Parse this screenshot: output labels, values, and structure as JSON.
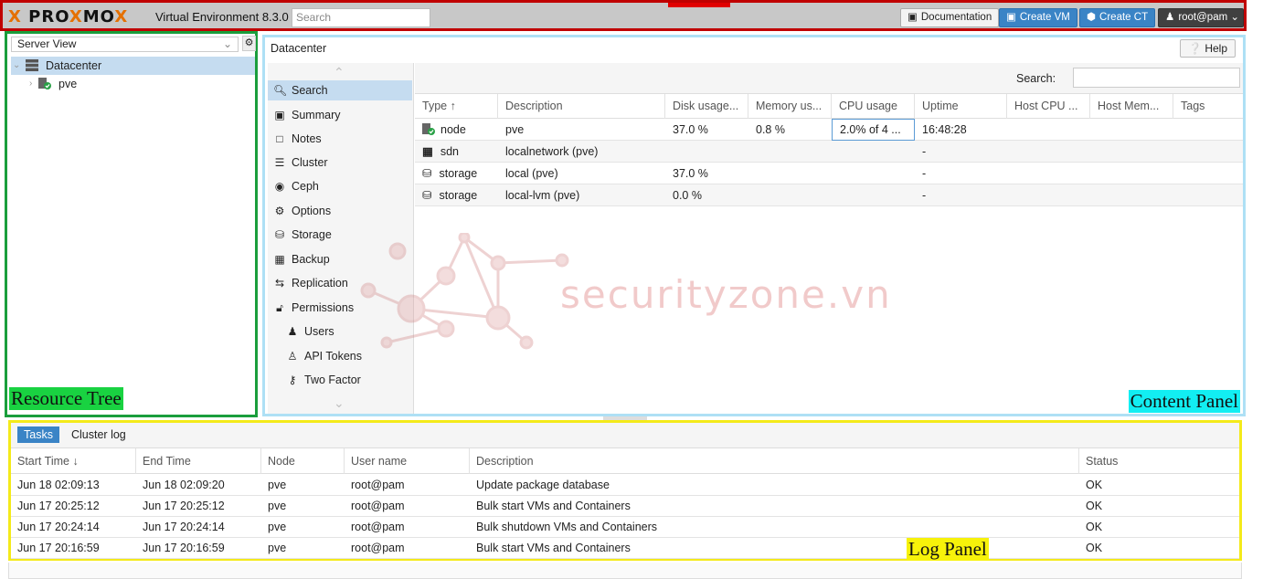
{
  "header": {
    "logo_text": "PROXMOX",
    "version": "Virtual Environment 8.3.0",
    "search_placeholder": "Search",
    "documentation": "Documentation",
    "create_vm": "Create VM",
    "create_ct": "Create CT",
    "user": "root@pam"
  },
  "tree": {
    "view": "Server View",
    "items": [
      {
        "label": "Datacenter",
        "icon": "server-rack-icon"
      },
      {
        "label": "pve",
        "icon": "node-online-icon"
      }
    ],
    "annotation": "Resource Tree"
  },
  "content": {
    "breadcrumb": "Datacenter",
    "help": "Help",
    "annotation": "Content Panel",
    "nav": [
      {
        "label": "Search",
        "icon": "search-icon"
      },
      {
        "label": "Summary",
        "icon": "book-icon"
      },
      {
        "label": "Notes",
        "icon": "note-icon"
      },
      {
        "label": "Cluster",
        "icon": "server-icon"
      },
      {
        "label": "Ceph",
        "icon": "ceph-icon"
      },
      {
        "label": "Options",
        "icon": "gear-icon"
      },
      {
        "label": "Storage",
        "icon": "database-icon"
      },
      {
        "label": "Backup",
        "icon": "floppy-icon"
      },
      {
        "label": "Replication",
        "icon": "retweet-icon"
      },
      {
        "label": "Permissions",
        "icon": "unlock-icon"
      },
      {
        "label": "Users",
        "icon": "user-icon"
      },
      {
        "label": "API Tokens",
        "icon": "user-outline-icon"
      },
      {
        "label": "Two Factor",
        "icon": "key-icon"
      }
    ],
    "search_label": "Search:",
    "columns": [
      "Type",
      "Description",
      "Disk usage...",
      "Memory us...",
      "CPU usage",
      "Uptime",
      "Host CPU ...",
      "Host Mem...",
      "Tags"
    ],
    "rows": [
      {
        "type": "node",
        "icon": "node-online-icon",
        "description": "pve",
        "disk": "37.0 %",
        "memory": "0.8 %",
        "cpu": "2.0% of 4 ...",
        "uptime": "16:48:28"
      },
      {
        "type": "sdn",
        "icon": "grid-icon",
        "description": "localnetwork (pve)",
        "disk": "",
        "memory": "",
        "cpu": "",
        "uptime": "-"
      },
      {
        "type": "storage",
        "icon": "database-icon",
        "description": "local (pve)",
        "disk": "37.0 %",
        "memory": "",
        "cpu": "",
        "uptime": "-"
      },
      {
        "type": "storage",
        "icon": "database-icon",
        "description": "local-lvm (pve)",
        "disk": "0.0 %",
        "memory": "",
        "cpu": "",
        "uptime": "-"
      }
    ]
  },
  "watermark": "securityzone.vn",
  "log": {
    "tabs": [
      "Tasks",
      "Cluster log"
    ],
    "columns": [
      "Start Time",
      "End Time",
      "Node",
      "User name",
      "Description",
      "Status"
    ],
    "rows": [
      {
        "start": "Jun 18 02:09:13",
        "end": "Jun 18 02:09:20",
        "node": "pve",
        "user": "root@pam",
        "description": "Update package database",
        "status": "OK"
      },
      {
        "start": "Jun 17 20:25:12",
        "end": "Jun 17 20:25:12",
        "node": "pve",
        "user": "root@pam",
        "description": "Bulk start VMs and Containers",
        "status": "OK"
      },
      {
        "start": "Jun 17 20:24:14",
        "end": "Jun 17 20:24:14",
        "node": "pve",
        "user": "root@pam",
        "description": "Bulk shutdown VMs and Containers",
        "status": "OK"
      },
      {
        "start": "Jun 17 20:16:59",
        "end": "Jun 17 20:16:59",
        "node": "pve",
        "user": "root@pam",
        "description": "Bulk start VMs and Containers",
        "status": "OK"
      }
    ],
    "annotation": "Log Panel"
  }
}
